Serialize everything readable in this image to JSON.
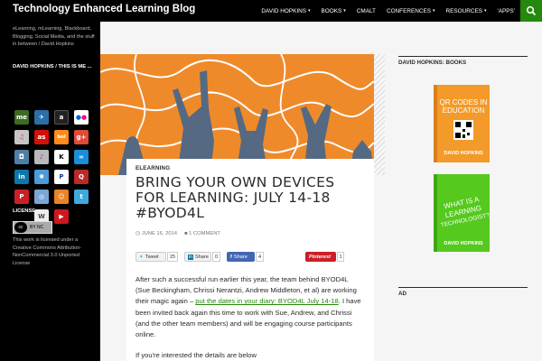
{
  "site": {
    "title": "Technology Enhanced Learning Blog",
    "tagline": "eLearning, mLearning, Blackboard, Blogging, Social Media, and the stuff in between / David Hopkins"
  },
  "nav": {
    "items": [
      {
        "label": "DAVID HOPKINS",
        "caret": true
      },
      {
        "label": "BOOKS",
        "caret": true
      },
      {
        "label": "CMALT",
        "caret": false
      },
      {
        "label": "CONFERENCES",
        "caret": true
      },
      {
        "label": "RESOURCES",
        "caret": true
      },
      {
        "label": "'APPS'",
        "caret": false
      }
    ]
  },
  "left_sidebar": {
    "profile_heading": "DAVID HOPKINS / THIS IS ME ...",
    "social_icons": [
      "me",
      "tripit",
      "amazon",
      "flickr",
      "itunes",
      "lastfm",
      "bol",
      "google-plus",
      "instagram",
      "itunes-2",
      "kindle",
      "kobo",
      "linkedin",
      "blog",
      "paypal",
      "quora",
      "pinterest",
      "itunes-3",
      "slideshare",
      "twitter",
      "wordpress",
      "youtube"
    ],
    "license_heading": "LICENSE",
    "license_badge": {
      "cc": "cc",
      "by": "BY NC"
    },
    "license_text": "This work is licensed under a Creative Commons Attribution-NonCommercial 3.0 Unported License"
  },
  "post": {
    "category": "ELEARNING",
    "title": "BRING YOUR OWN DEVICES FOR LEARNING: JULY 14-18 #BYOD4L",
    "date": "JUNE 16, 2014",
    "comments": "1 COMMENT",
    "share": {
      "tweet_label": "Tweet",
      "tweet_count": "25",
      "linkedin_label": "Share",
      "linkedin_count": "0",
      "facebook_label": "Share",
      "facebook_count": "4",
      "pinterest_label": "Pinterest",
      "pinterest_count": "1"
    },
    "paragraph1_start": "After such a successful run earlier this year, the team behind BYOD4L (Sue Beckingham, Chrissi Nerantzi, Andrew Middleton, et al) are working their magic again – ",
    "paragraph1_link": "put the dates in your diary: BYOD4L July 14-18",
    "paragraph1_end": ". I have been invited back again this time to work with Sue, Andrew, and Chrissi (and the other team members) and will be engaging course participants online.",
    "paragraph2": "If you're interested the details are below"
  },
  "right_sidebar": {
    "books_heading": "DAVID HOPKINS: BOOKS",
    "book1": {
      "title": "QR CODES IN EDUCATION",
      "author": "DAVID HOPKINS"
    },
    "book2": {
      "title": "WHAT IS A LEARNING TECHNOLOGIST?",
      "author": "DAVID HOPKINS"
    },
    "ad_heading": "AD"
  },
  "colors": {
    "accent_green": "#24890d",
    "header_black": "#000000",
    "banner_orange": "#ef8a2b",
    "book1_orange": "#f39a2a",
    "book2_green": "#55c91e"
  },
  "icons": {
    "search": "search-icon",
    "comment": "comment-icon",
    "clock": "clock-icon"
  }
}
